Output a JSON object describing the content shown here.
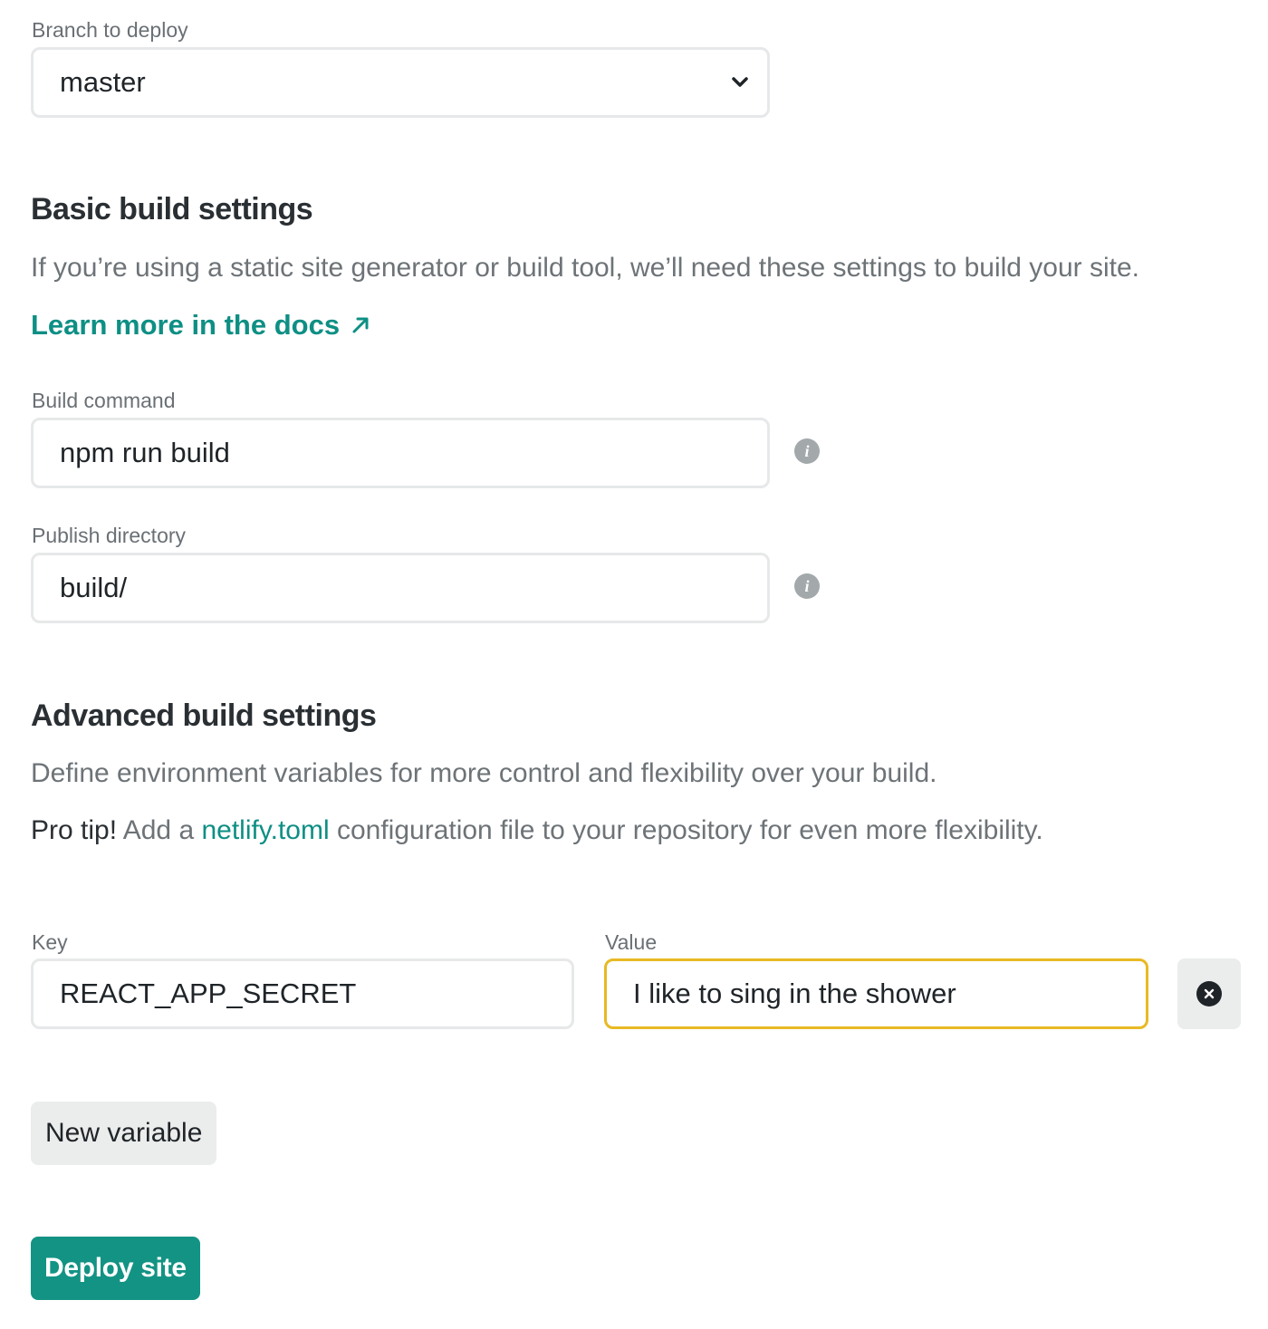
{
  "branch": {
    "label": "Branch to deploy",
    "selected": "master",
    "icon": "chevron-down-icon"
  },
  "basic": {
    "heading": "Basic build settings",
    "description": "If you’re using a static site generator or build tool, we’ll need these settings to build your site.",
    "docs_link": "Learn more in the docs",
    "docs_link_icon": "arrow-up-right-icon",
    "build_command": {
      "label": "Build command",
      "value": "npm run build",
      "info_icon": "info-icon"
    },
    "publish_directory": {
      "label": "Publish directory",
      "value": "build/",
      "info_icon": "info-icon"
    }
  },
  "advanced": {
    "heading": "Advanced build settings",
    "description": "Define environment variables for more control and flexibility over your build.",
    "pro_tip_label": "Pro tip!",
    "pro_tip_prefix": " Add a ",
    "pro_tip_link": "netlify.toml",
    "pro_tip_suffix": " configuration file to your repository for even more flexibility.",
    "key_label": "Key",
    "value_label": "Value",
    "variables": [
      {
        "key": "REACT_APP_SECRET",
        "value": "I like to sing in the shower"
      }
    ],
    "remove_icon": "close-circle-icon",
    "new_variable_label": "New variable"
  },
  "deploy_label": "Deploy site",
  "colors": {
    "accent": "#139384",
    "focus": "#e8b923"
  }
}
